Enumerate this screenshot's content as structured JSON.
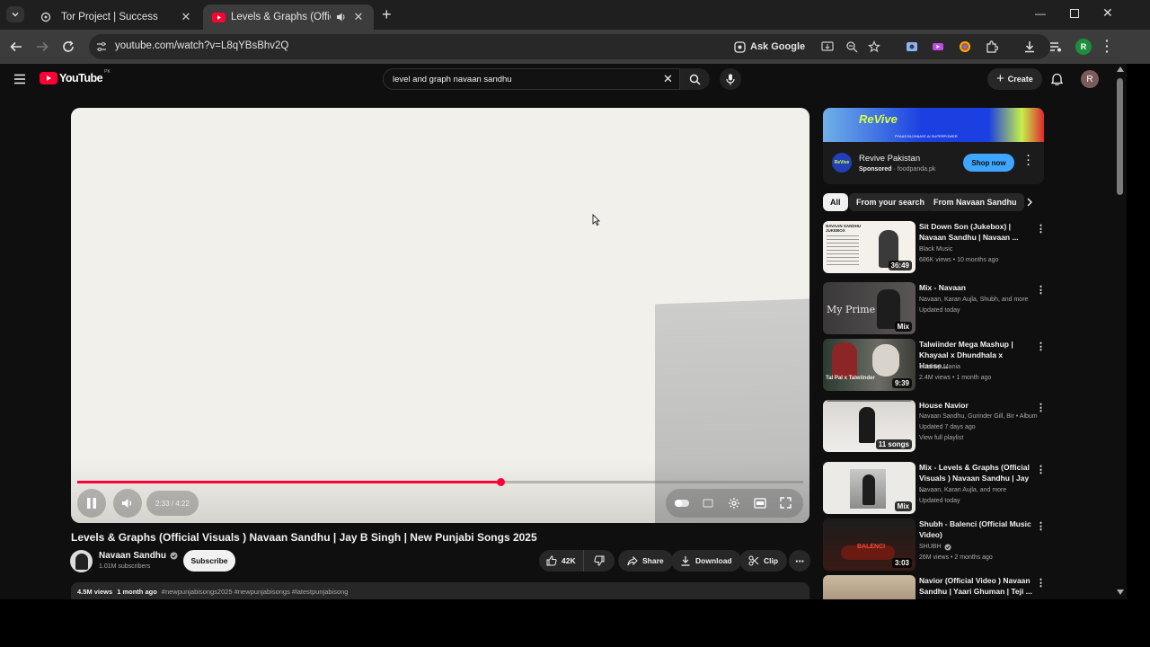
{
  "browser": {
    "tabs": [
      {
        "title": "Tor Project | Success",
        "active": false
      },
      {
        "title": "Levels & Graphs (Official Vi",
        "active": true
      }
    ],
    "url": "youtube.com/watch?v=L8qYBsBhv2Q",
    "ask_google": "Ask Google",
    "profile_initial": "R"
  },
  "youtube": {
    "logo_text": "YouTube",
    "region": "PK",
    "search_value": "level and graph navaan sandhu",
    "create_label": "Create",
    "avatar_initial": "R"
  },
  "player": {
    "time_label": "2:33 / 4:22",
    "progress": 0.583
  },
  "video": {
    "title": "Levels & Graphs (Official Visuals ) Navaan Sandhu | Jay B Singh | New Punjabi Songs 2025",
    "channel": "Navaan Sandhu",
    "subscribers": "1.01M subscribers",
    "subscribe_label": "Subscribe",
    "likes": "42K",
    "share_label": "Share",
    "download_label": "Download",
    "clip_label": "Clip",
    "views": "4.5M views",
    "age": "1 month ago",
    "hashtags": "#newpunjabisongs2025 #newpunjabisongs #latestpunjabisong"
  },
  "ad": {
    "banner_brand": "ReVive",
    "banner_tagline": "PYAAS BUJHAAYE AI SUPERPOWER",
    "name": "Revive Pakistan",
    "sponsored": "Sponsored",
    "domain": "foodpanda.pk",
    "cta": "Shop now"
  },
  "chips": [
    "All",
    "From your search",
    "From Navaan Sandhu"
  ],
  "recommendations": [
    {
      "title": "Sit Down Son (Jukebox) | Navaan Sandhu | Navaan ...",
      "meta1": "Black Music",
      "meta2": "686K views • 10 months ago",
      "badge": "36:49",
      "thumb_text": "NAVAAN SANDHU JUKEBOX"
    },
    {
      "title": "Mix - Navaan",
      "meta1": "Navaan, Karan Aujla, Shubh, and more",
      "meta2": "Updated today",
      "badge": "Mix",
      "thumb_text": "My Prime"
    },
    {
      "title": "Talwiinder Mega Mashup | Khayaal x  Dhundhala x Hasse...",
      "meta1": "Mashup Mania",
      "meta2": "2.4M views • 1 month ago",
      "badge": "9:39",
      "thumb_text": "Tal Pal x Talwiinder"
    },
    {
      "title": "House Navior",
      "meta1": "Navaan Sandhu, Gurinder Gill, Bir • Album",
      "meta2": "Updated 7 days ago",
      "meta3": "View full playlist",
      "badge": "11 songs"
    },
    {
      "title": "Mix - Levels & Graphs (Official Visuals ) Navaan Sandhu | Jay ...",
      "meta1": "Navaan, Karan Aujla, and more",
      "meta2": "Updated today",
      "badge": "Mix"
    },
    {
      "title": "Shubh - Balenci (Official Music Video)",
      "meta1": "SHUBH",
      "meta2": "26M views • 2 months ago",
      "badge": "3:03",
      "thumb_text": "BALENCI"
    },
    {
      "title": "Navior (Official Video ) Navaan Sandhu | Yaari Ghuman | Teji ...",
      "meta1": "",
      "meta2": "",
      "badge": ""
    }
  ],
  "colors": {
    "accent_red": "#ff0033",
    "ad_blue": "#3ea6ff",
    "page_bg": "#0f0f0f"
  }
}
